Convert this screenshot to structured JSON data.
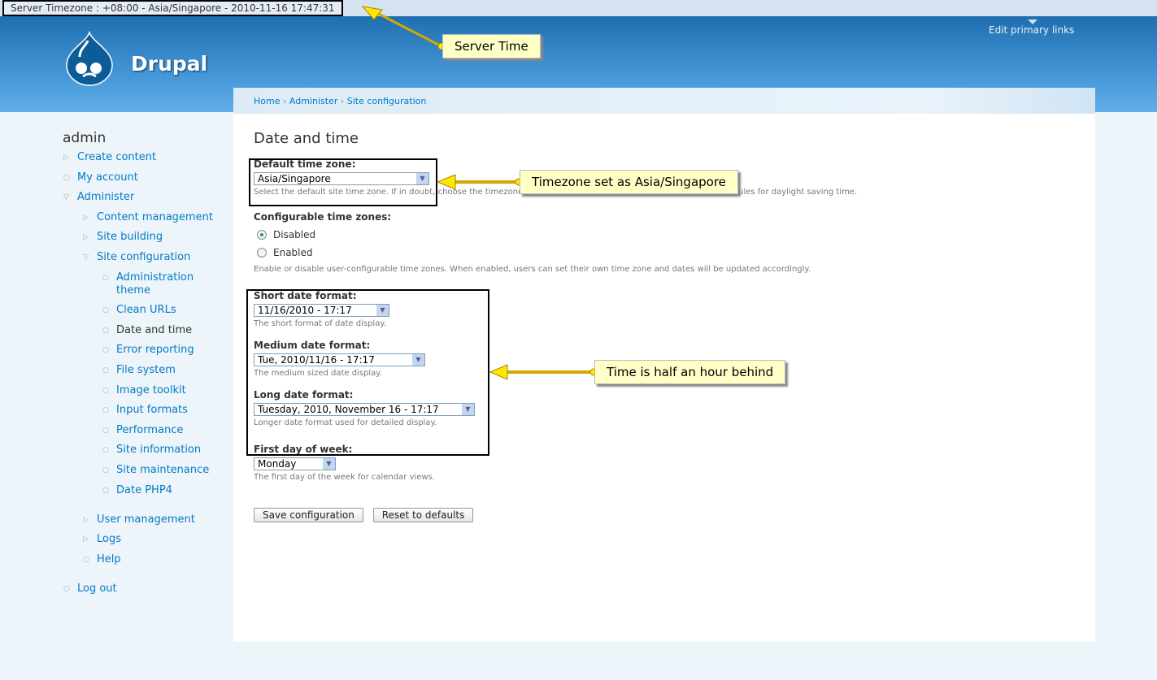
{
  "topbar": {
    "server_time": "Server Timezone : +08:00 - Asia/Singapore - 2010-11-16 17:47:31"
  },
  "header": {
    "site_name": "Drupal",
    "edit_primary_links": "Edit primary links"
  },
  "breadcrumb": [
    "Home",
    "Administer",
    "Site configuration"
  ],
  "sidebar": {
    "title": "admin",
    "items": [
      {
        "label": "Create content",
        "level": 1,
        "type": "col"
      },
      {
        "label": "My account",
        "level": 1,
        "type": "leaf"
      },
      {
        "label": "Administer",
        "level": 1,
        "type": "exp"
      },
      {
        "label": "Content management",
        "level": 2,
        "type": "col"
      },
      {
        "label": "Site building",
        "level": 2,
        "type": "col"
      },
      {
        "label": "Site configuration",
        "level": 2,
        "type": "exp"
      },
      {
        "label": "Administration theme",
        "level": 3,
        "type": "leaf"
      },
      {
        "label": "Clean URLs",
        "level": 3,
        "type": "leaf"
      },
      {
        "label": "Date and time",
        "level": 3,
        "type": "leaf",
        "active": true
      },
      {
        "label": "Error reporting",
        "level": 3,
        "type": "leaf"
      },
      {
        "label": "File system",
        "level": 3,
        "type": "leaf"
      },
      {
        "label": "Image toolkit",
        "level": 3,
        "type": "leaf"
      },
      {
        "label": "Input formats",
        "level": 3,
        "type": "leaf"
      },
      {
        "label": "Performance",
        "level": 3,
        "type": "leaf"
      },
      {
        "label": "Site information",
        "level": 3,
        "type": "leaf"
      },
      {
        "label": "Site maintenance",
        "level": 3,
        "type": "leaf"
      },
      {
        "label": "Date PHP4",
        "level": 3,
        "type": "leaf"
      },
      {
        "label": "User management",
        "level": 2,
        "type": "col"
      },
      {
        "label": "Logs",
        "level": 2,
        "type": "col"
      },
      {
        "label": "Help",
        "level": 2,
        "type": "leaf"
      },
      {
        "label": "Log out",
        "level": 1,
        "type": "leaf"
      }
    ]
  },
  "form": {
    "title": "Date and time",
    "default_tz": {
      "label": "Default time zone:",
      "value": "Asia/Singapore",
      "desc": "Select the default site time zone. If in doubt, choose the timezone that is closest to your location which has the same rules for daylight saving time."
    },
    "configurable": {
      "label": "Configurable time zones:",
      "options": [
        "Disabled",
        "Enabled"
      ],
      "selected": "Disabled",
      "desc": "Enable or disable user-configurable time zones. When enabled, users can set their own time zone and dates will be updated accordingly."
    },
    "short": {
      "label": "Short date format:",
      "value": "11/16/2010 - 17:17",
      "desc": "The short format of date display."
    },
    "medium": {
      "label": "Medium date format:",
      "value": "Tue, 2010/11/16 - 17:17",
      "desc": "The medium sized date display."
    },
    "long": {
      "label": "Long date format:",
      "value": "Tuesday, 2010, November 16 - 17:17",
      "desc": "Longer date format used for detailed display."
    },
    "first_day": {
      "label": "First day of week:",
      "value": "Monday",
      "desc": "The first day of the week for calendar views."
    },
    "save": "Save configuration",
    "reset": "Reset to defaults"
  },
  "annotations": {
    "server_time": "Server Time",
    "timezone": "Timezone set as Asia/Singapore",
    "behind": "Time is half an hour behind"
  }
}
